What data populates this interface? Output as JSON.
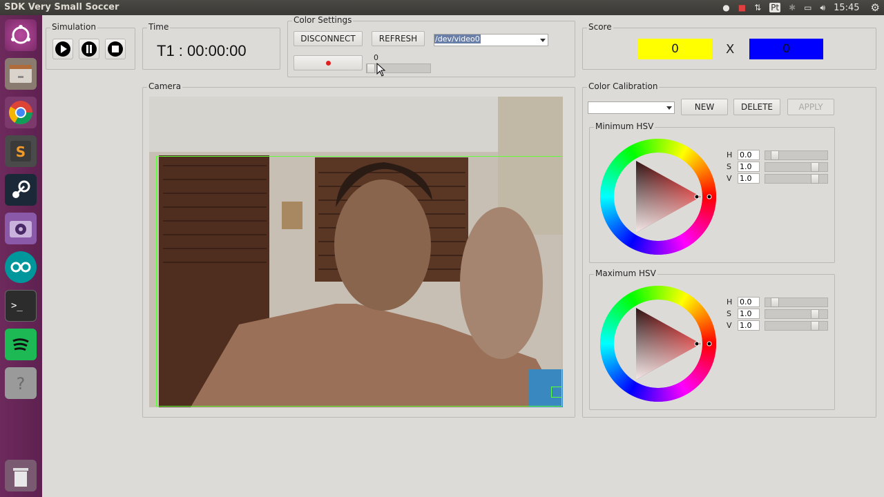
{
  "window": {
    "title": "SDK Very Small Soccer"
  },
  "tray": {
    "clock": "15:45",
    "pt_label": "Pt"
  },
  "simulation": {
    "legend": "Simulation"
  },
  "time": {
    "legend": "Time",
    "value": "T1 : 00:00:00"
  },
  "color_settings": {
    "legend": "Color Settings",
    "disconnect_label": "DISCONNECT",
    "refresh_label": "REFRESH",
    "device_value": "/dev/video0",
    "slider_value": "0",
    "slider_fraction": 0.0
  },
  "score": {
    "legend": "Score",
    "team_a": "0",
    "team_b": "0",
    "separator": "X",
    "team_a_color": "#ffff00",
    "team_b_color": "#0000ff"
  },
  "camera": {
    "legend": "Camera"
  },
  "color_calibration": {
    "legend": "Color Calibration",
    "preset_value": "",
    "new_label": "NEW",
    "delete_label": "DELETE",
    "apply_label": "APPLY"
  },
  "min_hsv": {
    "legend": "Minimum HSV",
    "h_label": "H",
    "s_label": "S",
    "v_label": "V",
    "h": "0.0",
    "s": "1.0",
    "v": "1.0"
  },
  "max_hsv": {
    "legend": "Maximum HSV",
    "h_label": "H",
    "s_label": "S",
    "v_label": "V",
    "h": "0.0",
    "s": "1.0",
    "v": "1.0"
  },
  "colors": {
    "accent_record": "#e02020",
    "detection_box": "#5fff3a"
  },
  "launcher_icons": [
    "ubuntu-dash-icon",
    "files-icon",
    "chrome-icon",
    "sublime-icon",
    "steam-icon",
    "webcam-icon",
    "arduino-icon",
    "terminal-icon",
    "spotify-icon",
    "help-icon",
    "trash-icon"
  ]
}
